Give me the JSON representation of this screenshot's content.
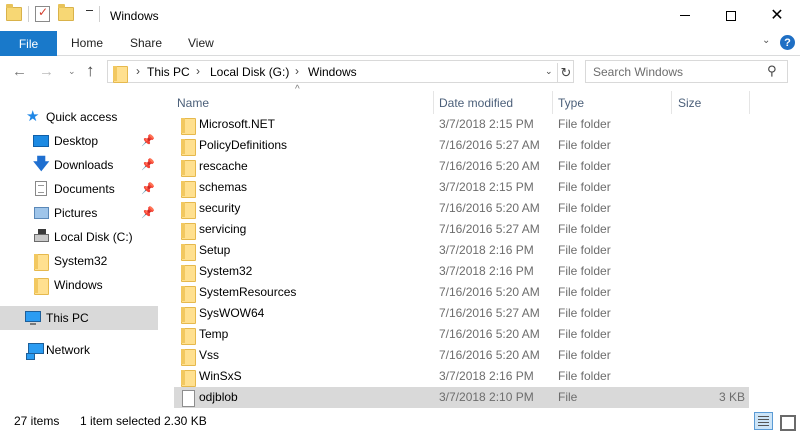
{
  "window": {
    "title": "Windows"
  },
  "ribbon": {
    "tabs": [
      "File",
      "Home",
      "Share",
      "View"
    ]
  },
  "address": {
    "crumbs": [
      "This PC",
      "Local Disk (G:)",
      "Windows"
    ]
  },
  "search": {
    "placeholder": "Search Windows"
  },
  "sidebar": {
    "items": [
      {
        "label": "Quick access",
        "icon": "star-icon"
      },
      {
        "label": "Desktop",
        "icon": "desktop-icon",
        "pinned": true
      },
      {
        "label": "Downloads",
        "icon": "download-icon",
        "pinned": true
      },
      {
        "label": "Documents",
        "icon": "documents-icon",
        "pinned": true
      },
      {
        "label": "Pictures",
        "icon": "pictures-icon",
        "pinned": true
      },
      {
        "label": "Local Disk (C:)",
        "icon": "drive-icon"
      },
      {
        "label": "System32",
        "icon": "folder-icon"
      },
      {
        "label": "Windows",
        "icon": "folder-icon"
      },
      {
        "label": "This PC",
        "icon": "computer-icon",
        "selected": true
      },
      {
        "label": "Network",
        "icon": "network-icon"
      }
    ]
  },
  "columns": {
    "name": "Name",
    "date": "Date modified",
    "type": "Type",
    "size": "Size"
  },
  "files": [
    {
      "name": "Microsoft.NET",
      "date": "3/7/2018 2:15 PM",
      "type": "File folder",
      "size": ""
    },
    {
      "name": "PolicyDefinitions",
      "date": "7/16/2016 5:27 AM",
      "type": "File folder",
      "size": ""
    },
    {
      "name": "rescache",
      "date": "7/16/2016 5:20 AM",
      "type": "File folder",
      "size": ""
    },
    {
      "name": "schemas",
      "date": "3/7/2018 2:15 PM",
      "type": "File folder",
      "size": ""
    },
    {
      "name": "security",
      "date": "7/16/2016 5:20 AM",
      "type": "File folder",
      "size": ""
    },
    {
      "name": "servicing",
      "date": "7/16/2016 5:27 AM",
      "type": "File folder",
      "size": ""
    },
    {
      "name": "Setup",
      "date": "3/7/2018 2:16 PM",
      "type": "File folder",
      "size": ""
    },
    {
      "name": "System32",
      "date": "3/7/2018 2:16 PM",
      "type": "File folder",
      "size": ""
    },
    {
      "name": "SystemResources",
      "date": "7/16/2016 5:20 AM",
      "type": "File folder",
      "size": ""
    },
    {
      "name": "SysWOW64",
      "date": "7/16/2016 5:27 AM",
      "type": "File folder",
      "size": ""
    },
    {
      "name": "Temp",
      "date": "7/16/2016 5:20 AM",
      "type": "File folder",
      "size": ""
    },
    {
      "name": "Vss",
      "date": "7/16/2016 5:20 AM",
      "type": "File folder",
      "size": ""
    },
    {
      "name": "WinSxS",
      "date": "3/7/2018 2:16 PM",
      "type": "File folder",
      "size": ""
    },
    {
      "name": "odjblob",
      "date": "3/7/2018 2:10 PM",
      "type": "File",
      "size": "3 KB",
      "selected": true
    }
  ],
  "status": {
    "item_count": "27 items",
    "selection": "1 item selected",
    "selection_size": "2.30 KB"
  }
}
